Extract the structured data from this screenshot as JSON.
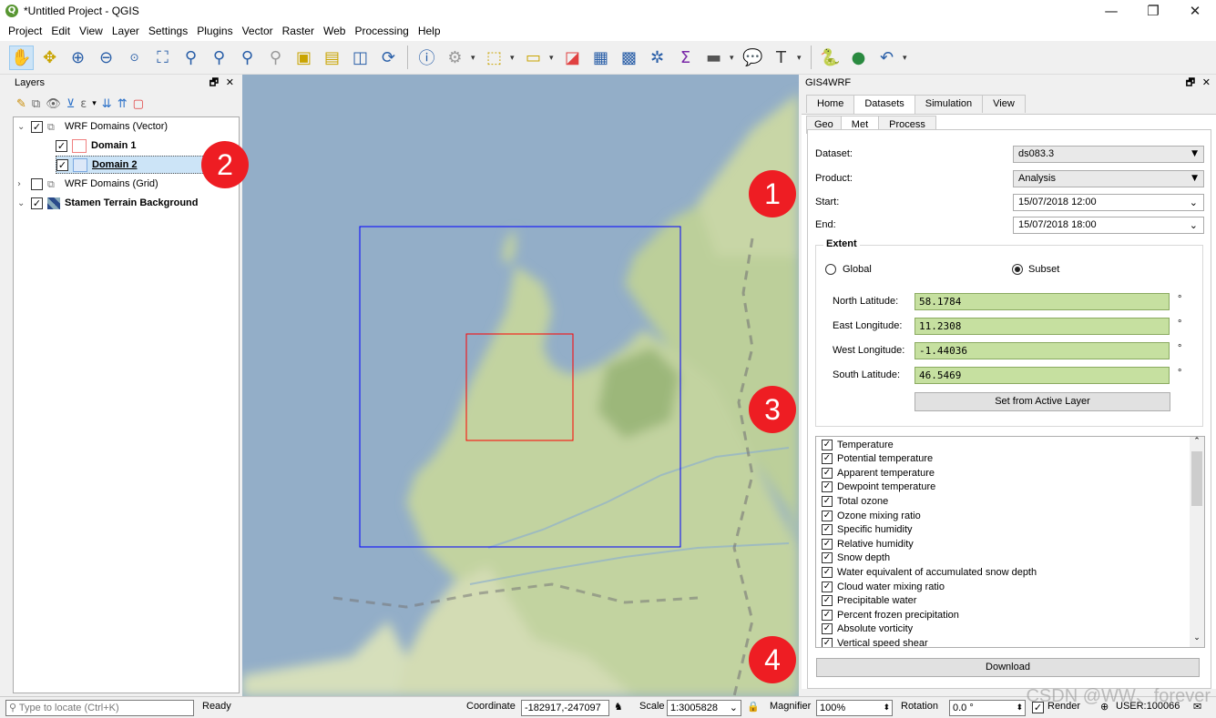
{
  "window": {
    "title": "*Untitled Project - QGIS",
    "app_icon": "qgis-icon",
    "minimize": "—",
    "maximize": "❐",
    "close": "✕"
  },
  "menu": [
    "Project",
    "Edit",
    "View",
    "Layer",
    "Settings",
    "Plugins",
    "Vector",
    "Raster",
    "Web",
    "Processing",
    "Help"
  ],
  "toolbar": {
    "icons": [
      "pan-icon",
      "pan-to-selection-icon",
      "zoom-in-icon",
      "zoom-out-icon",
      "zoom-native-icon",
      "zoom-full-icon",
      "zoom-to-selection-icon",
      "zoom-to-layer-icon",
      "zoom-last-icon",
      "zoom-next-icon",
      "new-bookmark-icon",
      "show-bookmarks-icon",
      "temporal-icon",
      "refresh-icon",
      "identify-icon",
      "action-icon",
      "select-icon",
      "attribute-select-icon",
      "deselect-icon",
      "attribute-table-icon",
      "field-calculator-icon",
      "statistics-icon",
      "sum-icon",
      "measure-icon",
      "map-tips-icon",
      "text-annotation-icon",
      "python-icon",
      "plugin-globe-icon",
      "undo-icon"
    ]
  },
  "layers_panel": {
    "title": "Layers",
    "float_icon": "🗗",
    "close_icon": "✕",
    "items": [
      {
        "label": "WRF Domains (Vector)",
        "checked": true,
        "expanded": true,
        "bold": false
      },
      {
        "label": "Domain 1",
        "checked": true,
        "bold": true,
        "swatch": "#f4a8a8"
      },
      {
        "label": "Domain 2",
        "checked": true,
        "bold": true,
        "swatch": "#aac8ee",
        "selected": true
      },
      {
        "label": "WRF Domains (Grid)",
        "checked": false,
        "expanded": false,
        "bold": false
      },
      {
        "label": "Stamen Terrain Background",
        "checked": true,
        "expanded": true,
        "bold": true
      }
    ]
  },
  "map": {
    "domain1_color": "#0000ff",
    "domain2_color": "#ff0000"
  },
  "gis4wrf": {
    "title": "GIS4WRF",
    "float_icon": "🗗",
    "close_icon": "✕",
    "tabs": [
      "Home",
      "Datasets",
      "Simulation",
      "View"
    ],
    "subtabs": [
      "Geo",
      "Met",
      "Process"
    ],
    "dataset_label": "Dataset:",
    "dataset_value": "ds083.3",
    "product_label": "Product:",
    "product_value": "Analysis",
    "start_label": "Start:",
    "start_value": "15/07/2018 12:00",
    "end_label": "End:",
    "end_value": "15/07/2018 18:00",
    "extent_title": "Extent",
    "radio_global": "Global",
    "radio_subset": "Subset",
    "north_label": "North Latitude:",
    "north_value": "58.1784",
    "east_label": "East Longitude:",
    "east_value": "11.2308",
    "west_label": "West Longitude:",
    "west_value": "-1.44036",
    "south_label": "South Latitude:",
    "south_value": "46.5469",
    "degree": "°",
    "set_button": "Set from Active Layer",
    "variables": [
      "Temperature",
      "Potential temperature",
      "Apparent temperature",
      "Dewpoint temperature",
      "Total ozone",
      "Ozone mixing ratio",
      "Specific humidity",
      "Relative humidity",
      "Snow depth",
      "Water equivalent of accumulated snow depth",
      "Cloud water mixing ratio",
      "Precipitable water",
      "Percent frozen precipitation",
      "Absolute vorticity",
      "Vertical speed shear"
    ],
    "download_button": "Download"
  },
  "statusbar": {
    "locate_placeholder": "Type to locate (Ctrl+K)",
    "ready": "Ready",
    "coordinate_label": "Coordinate",
    "coordinate_value": "-182917,-247097",
    "scale_label": "Scale",
    "scale_value": "1:3005828",
    "magnifier_label": "Magnifier",
    "magnifier_value": "100%",
    "rotation_label": "Rotation",
    "rotation_value": "0.0 °",
    "render_label": "Render",
    "crs_label": "USER:100066"
  },
  "callouts": [
    "1",
    "2",
    "3",
    "4"
  ],
  "watermark": "CSDN @WW、forever"
}
